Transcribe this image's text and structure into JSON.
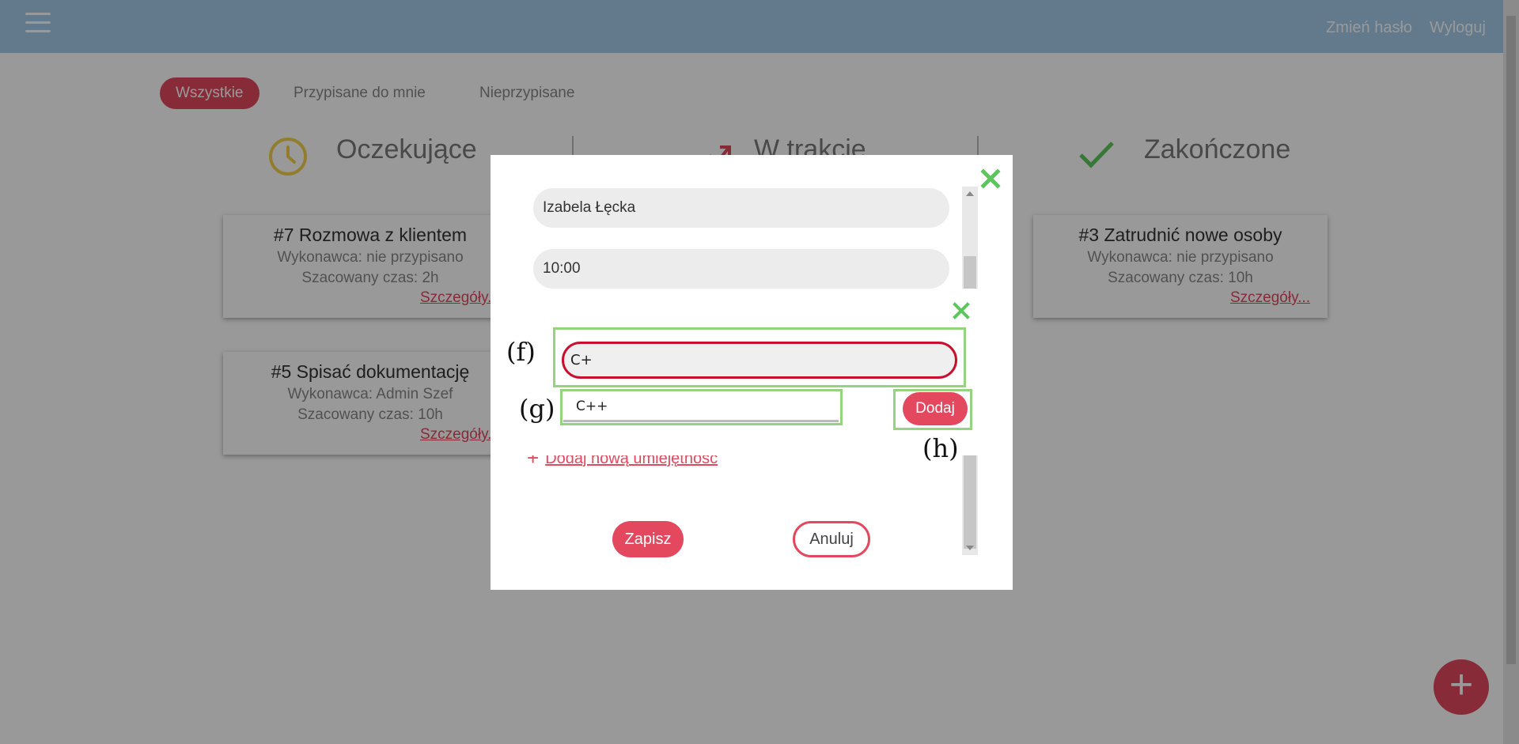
{
  "topbar": {
    "change_password": "Zmień hasło",
    "logout": "Wyloguj"
  },
  "tabs": [
    {
      "label": "Wszystkie",
      "active": true
    },
    {
      "label": "Przypisane do mnie",
      "active": false
    },
    {
      "label": "Nieprzypisane",
      "active": false
    }
  ],
  "columns": [
    {
      "title": "Oczekujące",
      "icon": "clock-icon",
      "color": "#f3d04f"
    },
    {
      "title": "W trakcie",
      "icon": "trending-up-icon",
      "color": "#e3485f"
    },
    {
      "title": "Zakończone",
      "icon": "check-icon",
      "color": "#5cc65c"
    }
  ],
  "cards": [
    {
      "title": "#7 Rozmowa z klientem",
      "assignee": "Wykonawca: nie przypisano",
      "time": "Szacowany czas: 2h",
      "link": "Szczegóły..."
    },
    {
      "title": "#5 Spisać dokumentację",
      "assignee": "Wykonawca: Admin Szef",
      "time": "Szacowany czas: 10h",
      "link": "Szczegóły..."
    },
    {
      "title": "#3 Zatrudnić nowe osoby",
      "assignee": "Wykonawca: nie przypisano",
      "time": "Szacowany czas: 10h",
      "link": "Szczegóły..."
    }
  ],
  "fab": {
    "label": "+"
  },
  "edit_modal": {
    "assignee_value": "Izabela Łęcka",
    "time_value": "10:00",
    "add_skill_label": "Dodaj nową umiejętność",
    "save_label": "Zapisz",
    "cancel_label": "Anuluj"
  },
  "skill_popup": {
    "input_value": "C+",
    "suggestion": "C++",
    "add_label": "Dodaj"
  },
  "annotations": {
    "f": "(f)",
    "g": "(g)",
    "h": "(h)"
  },
  "colors": {
    "accent": "#e3485f",
    "topbar": "#a3cbea",
    "annotation_box": "#94d47e"
  }
}
